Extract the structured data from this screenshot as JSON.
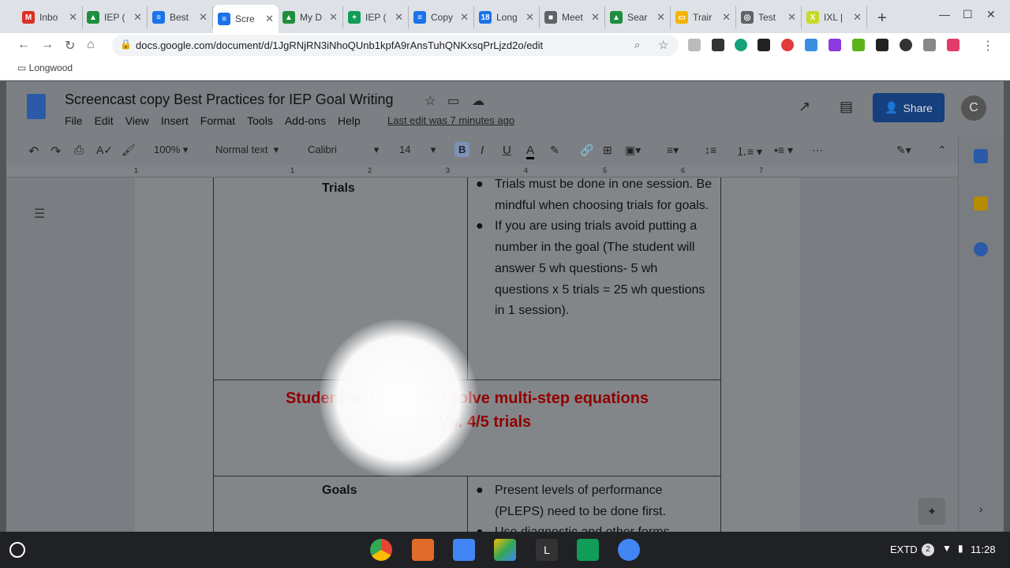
{
  "browser": {
    "tabs": [
      {
        "label": "Inbo",
        "favicon": "gmail-icon",
        "color": "#d93025",
        "glyph": "M"
      },
      {
        "label": "IEP (",
        "favicon": "drive-icon",
        "color": "#1e8e3e",
        "glyph": "▲"
      },
      {
        "label": "Best",
        "favicon": "docs-icon",
        "color": "#1a73e8",
        "glyph": "≡"
      },
      {
        "label": "Scre",
        "favicon": "docs-icon",
        "color": "#1a73e8",
        "glyph": "≡"
      },
      {
        "label": "My D",
        "favicon": "drive-icon",
        "color": "#1e8e3e",
        "glyph": "▲"
      },
      {
        "label": "IEP (",
        "favicon": "sheets-icon",
        "color": "#0f9d58",
        "glyph": "+"
      },
      {
        "label": "Copy",
        "favicon": "docs-icon",
        "color": "#1a73e8",
        "glyph": "≡"
      },
      {
        "label": "Long",
        "favicon": "calendar-icon",
        "color": "#1a73e8",
        "glyph": "18"
      },
      {
        "label": "Meet",
        "favicon": "meet-icon",
        "color": "#5f6368",
        "glyph": "■"
      },
      {
        "label": "Sear",
        "favicon": "drive-icon",
        "color": "#1e8e3e",
        "glyph": "▲"
      },
      {
        "label": "Trair",
        "favicon": "slides-icon",
        "color": "#f4b400",
        "glyph": "▭"
      },
      {
        "label": "Test",
        "favicon": "globe-icon",
        "color": "#5f6368",
        "glyph": "◎"
      },
      {
        "label": "IXL |",
        "favicon": "ixl-icon",
        "color": "#c6d92a",
        "glyph": "X"
      }
    ],
    "active_tab_index": 3,
    "url": "docs.google.com/document/d/1JgRNjRN3iNhoQUnb1kpfA9rAnsTuhQNKxsqPrLjzd2o/edit",
    "bookmark": "Longwood"
  },
  "doc": {
    "title": "Screencast copy Best Practices for IEP Goal Writing",
    "menu": [
      "File",
      "Edit",
      "View",
      "Insert",
      "Format",
      "Tools",
      "Add-ons",
      "Help"
    ],
    "last_edit": "Last edit was 7 minutes ago",
    "share_label": "Share",
    "avatar_letter": "C",
    "format": {
      "zoom": "100%",
      "style": "Normal text",
      "font": "Calibri",
      "size": "14"
    },
    "ruler_numbers": [
      "1",
      "1",
      "2",
      "3",
      "4",
      "5",
      "6",
      "7"
    ],
    "table": {
      "row1_title": "Trials",
      "row1_bullets": [
        "Trials must be done in one session. Be mindful when choosing trials for goals.",
        "If you are using trials avoid putting a number in the goal (The student will answer 5 wh questions- 5 wh questions x 5 trials = 25  wh questions in 1 session)."
      ],
      "goal_line1": "Student will correctly solve multi-step equations",
      "goal_line2": "80% Vs. 4/5 trials",
      "row3_title": "Goals",
      "row3_bullets": [
        "Present levels of performance (PLEPS) need to be done first.",
        "Use diagnostic and other forms"
      ]
    }
  },
  "shelf": {
    "extd": "EXTD",
    "notif_count": "2",
    "time": "11:28"
  }
}
